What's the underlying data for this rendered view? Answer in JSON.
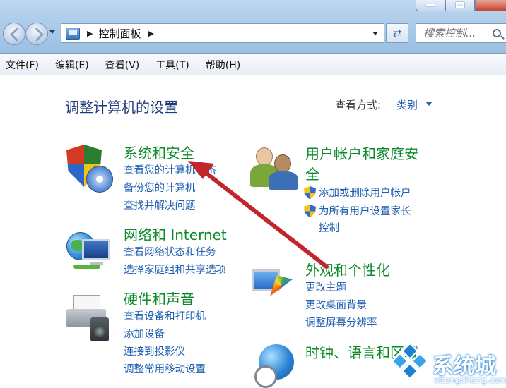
{
  "address_bar": {
    "path": "控制面板",
    "search_placeholder": "搜索控制..."
  },
  "menu": [
    "文件(F)",
    "编辑(E)",
    "查看(V)",
    "工具(T)",
    "帮助(H)"
  ],
  "page": {
    "title": "调整计算机的设置",
    "view_by_label": "查看方式:",
    "view_by_value": "类别"
  },
  "categories": {
    "system_security": {
      "title": "系统和安全",
      "links": [
        "查看您的计算机状态",
        "备份您的计算机",
        "查找并解决问题"
      ]
    },
    "network": {
      "title": "网络和 Internet",
      "links": [
        "查看网络状态和任务",
        "选择家庭组和共享选项"
      ]
    },
    "hardware": {
      "title": "硬件和声音",
      "links": [
        "查看设备和打印机",
        "添加设备",
        "连接到投影仪",
        "调整常用移动设置"
      ]
    },
    "users": {
      "title": "用户帐户和家庭安全",
      "links": [
        "添加或删除用户帐户",
        "为所有用户设置家长控制"
      ]
    },
    "appearance": {
      "title": "外观和个性化",
      "links": [
        "更改主题",
        "更改桌面背景",
        "调整屏幕分辨率"
      ]
    },
    "clock": {
      "title": "时钟、语言和区域"
    }
  },
  "annotation_color": "#c0262c",
  "watermark": {
    "name": "系统城",
    "url": "xitongcheng.com"
  }
}
